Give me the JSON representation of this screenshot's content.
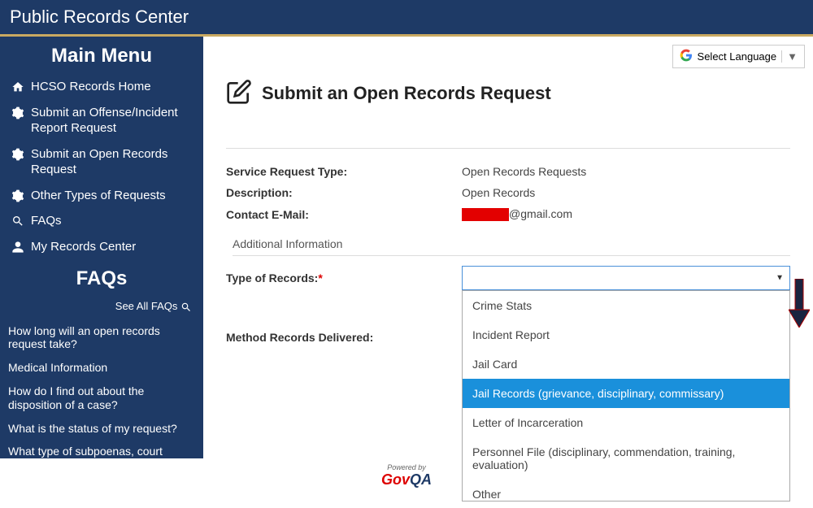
{
  "header": {
    "title": "Public Records Center"
  },
  "sidebar": {
    "menu_title": "Main Menu",
    "items": [
      {
        "label": "HCSO Records Home"
      },
      {
        "label": "Submit an Offense/Incident Report Request"
      },
      {
        "label": "Submit an Open Records Request"
      },
      {
        "label": "Other Types of Requests"
      },
      {
        "label": "FAQs"
      },
      {
        "label": "My Records Center"
      }
    ],
    "faqs_title": "FAQs",
    "see_all_label": "See All FAQs",
    "faqs": [
      "How long will an open records request take?",
      "Medical Information",
      "How do I find out about the disposition of a case?",
      "What is the status of my request?",
      "What type of subpoenas, court orders, or deposition by written questions does HCSO handle?"
    ]
  },
  "lang": {
    "label": "Select Language"
  },
  "page": {
    "title": "Submit an Open Records Request"
  },
  "form": {
    "service_type": {
      "label": "Service Request Type:",
      "value": "Open Records Requests"
    },
    "description": {
      "label": "Description:",
      "value": "Open Records"
    },
    "contact_email": {
      "label": "Contact E-Mail:",
      "suffix": "@gmail.com"
    },
    "section_heading": "Additional Information",
    "type_records": {
      "label": "Type of Records:"
    },
    "method_delivered": {
      "label": "Method Records Delivered:"
    },
    "dropdown_options": [
      "Crime Stats",
      "Incident Report",
      "Jail Card",
      "Jail Records (grievance, disciplinary, commissary)",
      "Letter of Incarceration",
      "Personnel File (disciplinary, commendation, training, evaluation)",
      "Other"
    ],
    "selected_index": 3
  },
  "footer": {
    "powered_by": "Powered by",
    "logo_gov": "Gov",
    "logo_qa": "QA"
  }
}
